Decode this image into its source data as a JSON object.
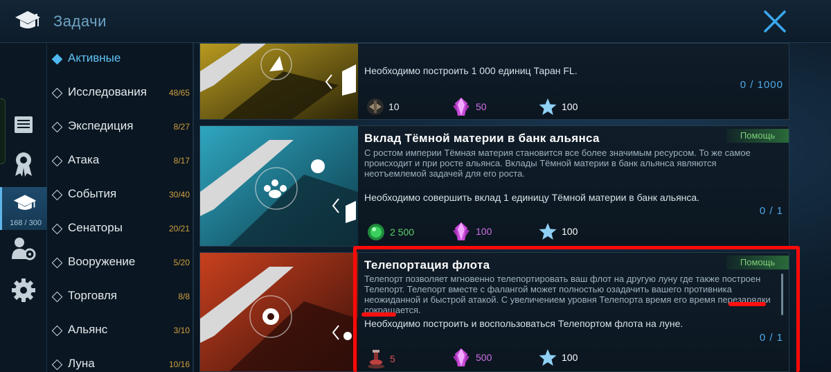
{
  "header": {
    "title": "Задачи"
  },
  "rail": {
    "count": "168 / 300"
  },
  "categories": [
    {
      "label": "Активные",
      "count": "",
      "active": true
    },
    {
      "label": "Исследования",
      "count": "48/65"
    },
    {
      "label": "Экспедиция",
      "count": "8/27"
    },
    {
      "label": "Атака",
      "count": "8/17"
    },
    {
      "label": "События",
      "count": "30/40"
    },
    {
      "label": "Сенаторы",
      "count": "20/21"
    },
    {
      "label": "Вооружение",
      "count": "5/20"
    },
    {
      "label": "Торговля",
      "count": "8/8"
    },
    {
      "label": "Альянс",
      "count": "3/10"
    },
    {
      "label": "Луна",
      "count": "10/16"
    }
  ],
  "cards": [
    {
      "title": "",
      "description": "",
      "requirement": "Необходимо построить 1 000 единиц Таран FL.",
      "progress": "0 / 1000",
      "rewards": [
        {
          "icon": "ship-icon",
          "value": "10"
        },
        {
          "icon": "crystal-icon",
          "value": "50"
        },
        {
          "icon": "star-icon",
          "value": "100"
        }
      ],
      "help": ""
    },
    {
      "title": "Вклад Тёмной материи в банк альянса",
      "description": "С ростом империи Тёмная материя становится все более значимым ресурсом. То же самое происходит и при росте альянса. Вклады Тёмной материи в банк альянса являются неотъемлемой задачей для его роста.",
      "requirement": "Необходимо совершить вклад 1 единицу Тёмной материи в банк альянса.",
      "progress": "0 / 1",
      "rewards": [
        {
          "icon": "dark-matter-icon",
          "value": "2 500"
        },
        {
          "icon": "crystal-icon",
          "value": "100"
        },
        {
          "icon": "star-icon",
          "value": "100"
        }
      ],
      "help": "Помощь"
    },
    {
      "title": "Телепортация флота",
      "description": "Телепорт позволяет мгновенно телепортировать ваш флот на другую луну где также построен Телепорт. Телепорт вместе с фалангой может полностью озадачить вашего противника неожиданной и быстрой атакой. С увеличением уровня Телепорта время его время перезарядки сокращается.",
      "requirement": "Необходимо построить и воспользоваться Телепортом флота на луне.",
      "progress": "0 / 1",
      "rewards": [
        {
          "icon": "teleport-icon",
          "value": "5"
        },
        {
          "icon": "crystal-icon",
          "value": "500"
        },
        {
          "icon": "star-icon",
          "value": "100"
        }
      ],
      "help": "Помощь"
    }
  ],
  "colors": {
    "accent": "#4fa9e8",
    "help": "#7fd07a",
    "count": "#d0a040",
    "highlight": "#ff0a0a",
    "green_reward": "#5fd06a",
    "purple_reward": "#d070e8",
    "red_reward": "#e05050"
  }
}
